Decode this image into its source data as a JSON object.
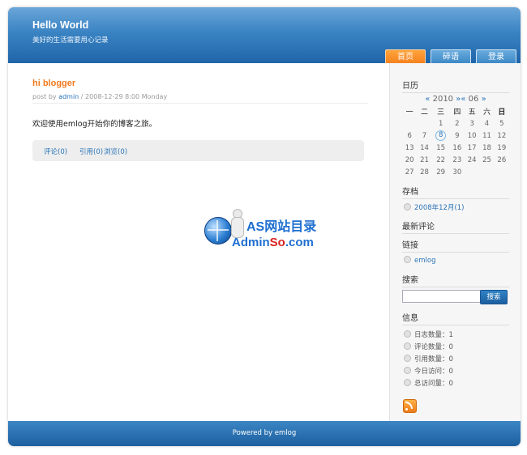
{
  "header": {
    "title": "Hello World",
    "subtitle": "美好的生活需要用心记录"
  },
  "nav": {
    "home": "首页",
    "fragments": "碎语",
    "login": "登录"
  },
  "post": {
    "title": "hi blogger",
    "meta_prefix": "post by ",
    "author": "admin",
    "meta_suffix": " / 2008-12-29 8:00 Monday",
    "body": "欢迎使用emlog开始你的博客之旅。",
    "comments": "评论(0)",
    "trackbacks": "引用(0)",
    "views": "浏览(0)"
  },
  "watermark": {
    "line1": "AS网站目录",
    "line2_a": "Admin",
    "line2_b": "So",
    "line2_c": ".com"
  },
  "calendar": {
    "heading": "日历",
    "prev_year": "«",
    "year": "2010",
    "next_year": "»",
    "prev_month": "«",
    "month": "06",
    "next_month": "»",
    "weekdays": [
      "一",
      "二",
      "三",
      "四",
      "五",
      "六",
      "日"
    ],
    "weeks": [
      [
        "",
        "",
        "1",
        "2",
        "3",
        "4",
        "5"
      ],
      [
        "6",
        "7",
        "8",
        "9",
        "10",
        "11",
        "12"
      ],
      [
        "13",
        "14",
        "15",
        "16",
        "17",
        "18",
        "19"
      ],
      [
        "20",
        "21",
        "22",
        "23",
        "24",
        "25",
        "26"
      ],
      [
        "27",
        "28",
        "29",
        "30",
        "",
        "",
        ""
      ]
    ],
    "today": "8"
  },
  "sidebar": {
    "archive_heading": "存档",
    "archive_item": "2008年12月(1)",
    "comments_heading": "最新评论",
    "links_heading": "链接",
    "link_item": "emlog",
    "search_heading": "搜索",
    "search_button": "搜索",
    "search_value": "",
    "info_heading": "信息",
    "info": [
      {
        "label": "日志数量：",
        "value": "1"
      },
      {
        "label": "评论数量：",
        "value": "0"
      },
      {
        "label": "引用数量：",
        "value": "0"
      },
      {
        "label": "今日访问：",
        "value": "0"
      },
      {
        "label": "总访问量：",
        "value": "0"
      }
    ]
  },
  "footer": {
    "text": "Powered by emlog"
  }
}
